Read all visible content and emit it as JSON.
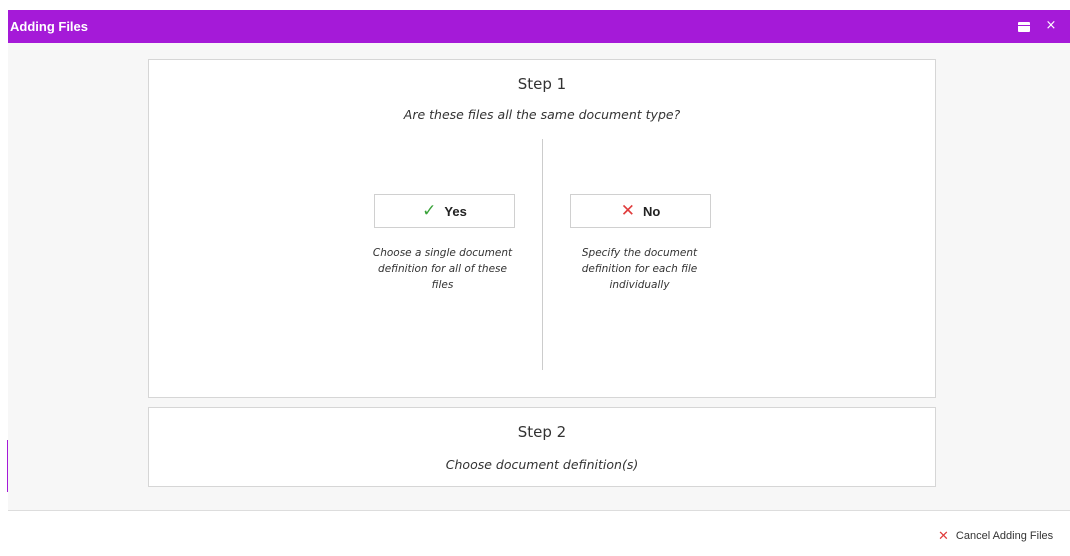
{
  "window": {
    "title": "Adding Files",
    "accent_color": "#a51ad8",
    "controls": {
      "maximize_icon": "window-maximize-icon",
      "close_icon": "close-icon",
      "close_glyph": "×"
    }
  },
  "step1": {
    "title": "Step 1",
    "question": "Are these files all the same document type?",
    "yes": {
      "icon": "checkmark-icon",
      "icon_glyph": "✓",
      "icon_color": "#3aa33a",
      "label": "Yes",
      "description": "Choose a single document definition for all of these files"
    },
    "no": {
      "icon": "x-icon",
      "icon_glyph": "✕",
      "icon_color": "#e03c3c",
      "label": "No",
      "description": "Specify the document definition for each file individually"
    }
  },
  "step2": {
    "title": "Step 2",
    "subtitle": "Choose document definition(s)"
  },
  "footer": {
    "cancel_icon": "x-icon",
    "cancel_glyph": "✕",
    "cancel_label": "Cancel Adding Files"
  }
}
